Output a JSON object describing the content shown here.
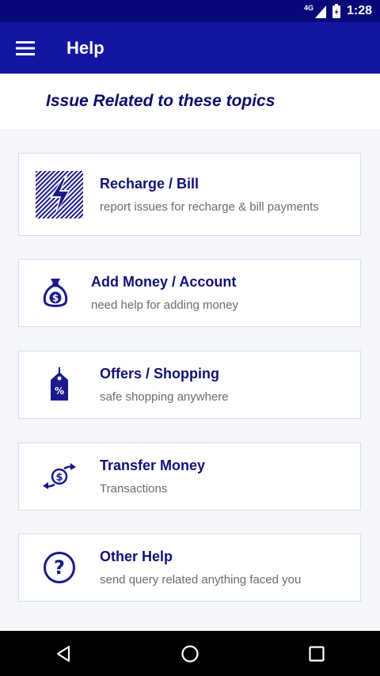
{
  "status_bar": {
    "network": "4G",
    "time": "1:28"
  },
  "app_bar": {
    "title": "Help",
    "menu_icon": "hamburger-menu-icon"
  },
  "header": {
    "text": "Issue Related to these topics"
  },
  "topics": [
    {
      "title": "Recharge / Bill",
      "subtitle": "report issues for recharge & bill payments",
      "icon": "lightning-bolt-icon"
    },
    {
      "title": "Add Money / Account",
      "subtitle": "need help for adding money",
      "icon": "money-bag-icon"
    },
    {
      "title": "Offers / Shopping",
      "subtitle": "safe shopping anywhere",
      "icon": "discount-tag-icon"
    },
    {
      "title": "Transfer Money",
      "subtitle": "Transactions",
      "icon": "money-transfer-icon"
    },
    {
      "title": "Other Help",
      "subtitle": "send query related anything faced you",
      "icon": "question-mark-icon"
    }
  ],
  "nav_bar": {
    "back": "back-icon",
    "home": "home-icon",
    "recents": "recents-icon"
  },
  "colors": {
    "status_bar": "#08087a",
    "app_bar": "#1515a3",
    "accent": "#1a1a8c",
    "title_text": "#111177"
  }
}
